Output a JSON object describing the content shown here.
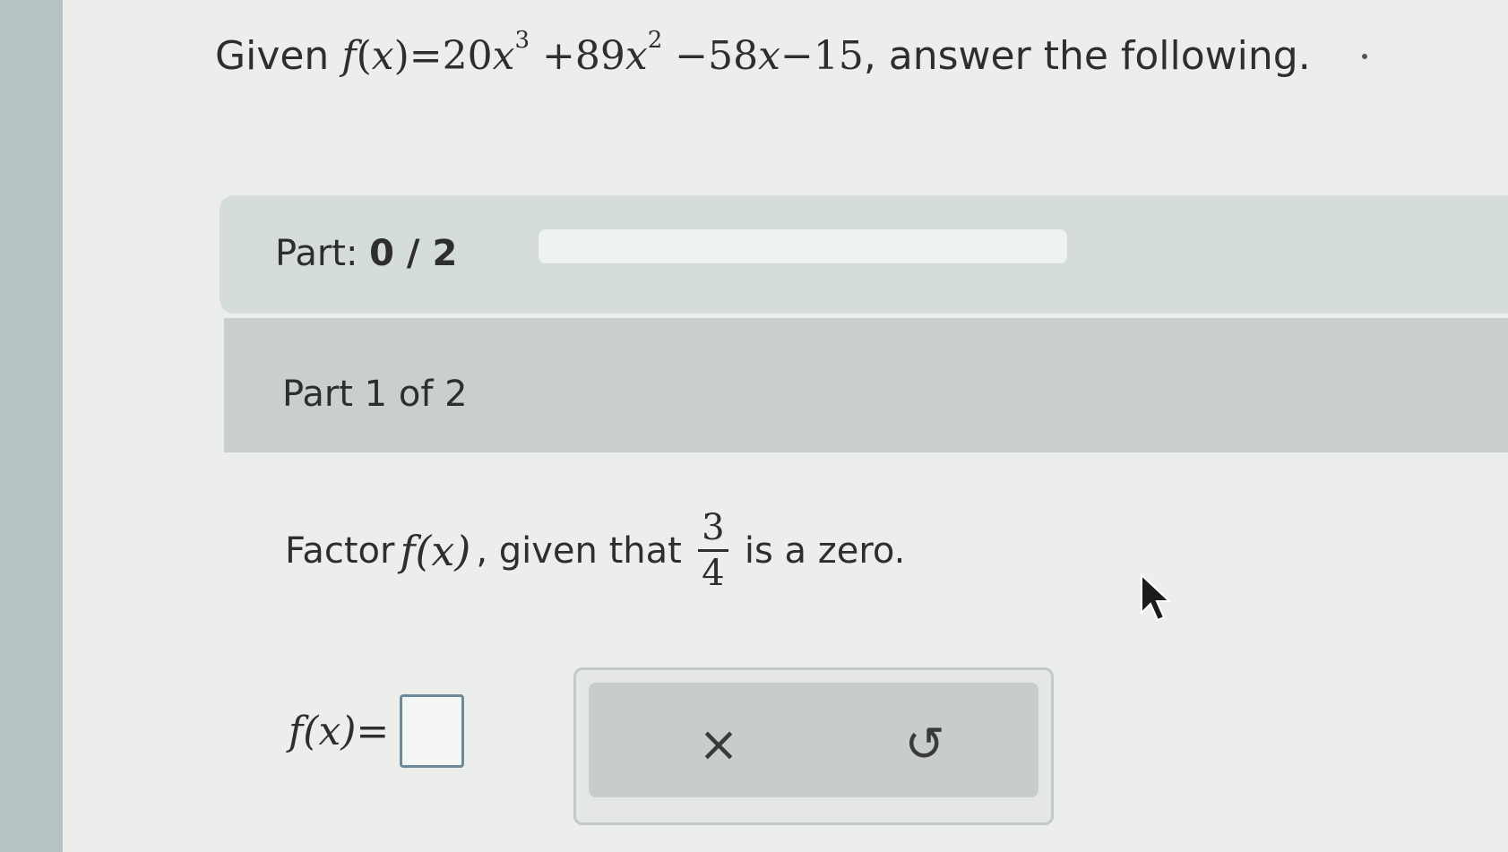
{
  "question": {
    "lead": "Given",
    "fn": "f",
    "var": "x",
    "eq": "=20",
    "exp3": "3",
    "t2": "+89",
    "exp2": "2",
    "t3": "−58",
    "t4": "−15",
    "tail": ", answer the following."
  },
  "progress": {
    "label": "Part:",
    "value": "0 / 2",
    "fraction": 0
  },
  "part": {
    "header": "Part 1 of 2"
  },
  "prompt": {
    "lead": "Factor",
    "fx": "f(x)",
    "mid": ", given that",
    "numerator": "3",
    "denominator": "4",
    "tail": "is a zero."
  },
  "answer": {
    "lhs": "f(x)=",
    "value": ""
  },
  "buttons": {
    "clear_icon": "×",
    "undo_icon": "↺"
  },
  "icons": {
    "clear": "close-icon",
    "undo": "undo-icon",
    "cursor": "mouse-pointer-icon"
  },
  "colors": {
    "progress_fill": "#5e9fcf",
    "part_bar": "#d4dcdc",
    "part_header": "#c9cfcd"
  }
}
